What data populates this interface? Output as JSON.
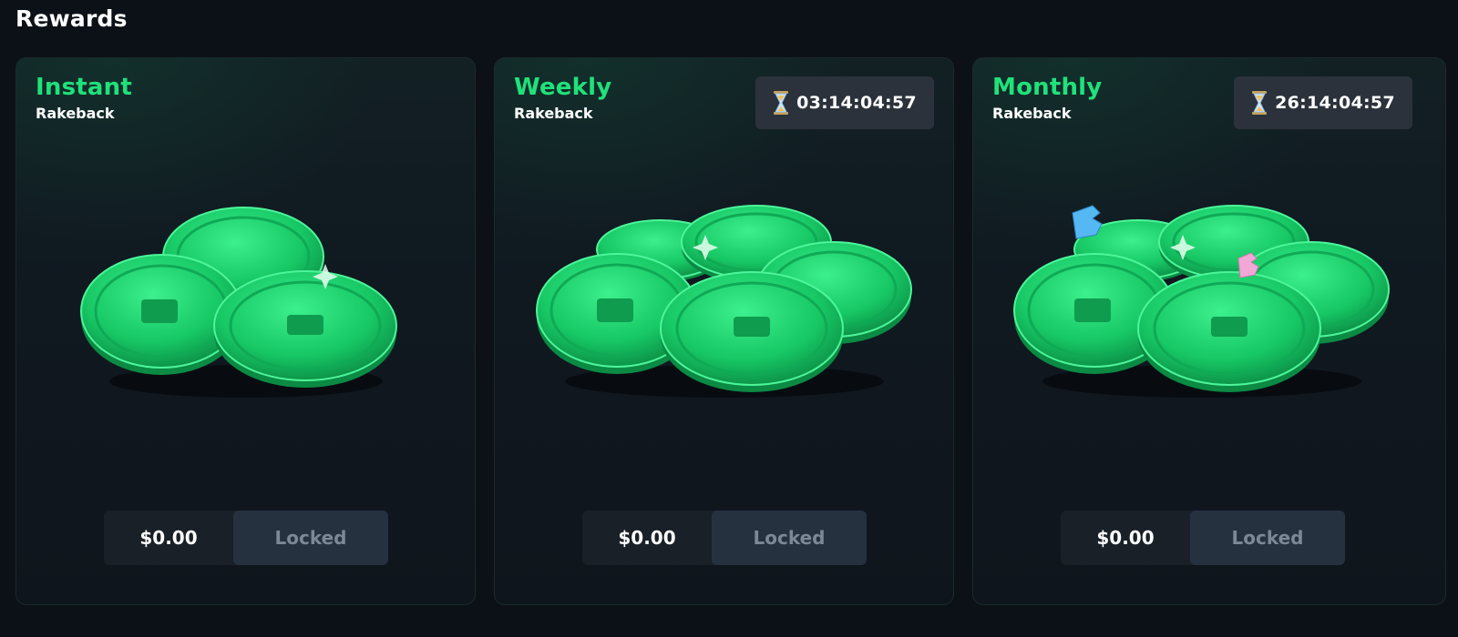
{
  "section": {
    "title": "Rewards"
  },
  "cards": [
    {
      "title": "Instant",
      "subtitle": "Rakeback",
      "timer": null,
      "amount": "$0.00",
      "button_label": "Locked"
    },
    {
      "title": "Weekly",
      "subtitle": "Rakeback",
      "timer": "03:14:04:57",
      "amount": "$0.00",
      "button_label": "Locked"
    },
    {
      "title": "Monthly",
      "subtitle": "Rakeback",
      "timer": "26:14:04:57",
      "amount": "$0.00",
      "button_label": "Locked"
    }
  ],
  "colors": {
    "accent_green": "#1fe27a",
    "card_bg": "#101820",
    "timer_bg": "#2b323b",
    "locked_bg": "#263140",
    "locked_text": "#7d8896"
  },
  "icons": {
    "timer": "hourglass-icon",
    "reward_art": "green-coins-icon"
  }
}
